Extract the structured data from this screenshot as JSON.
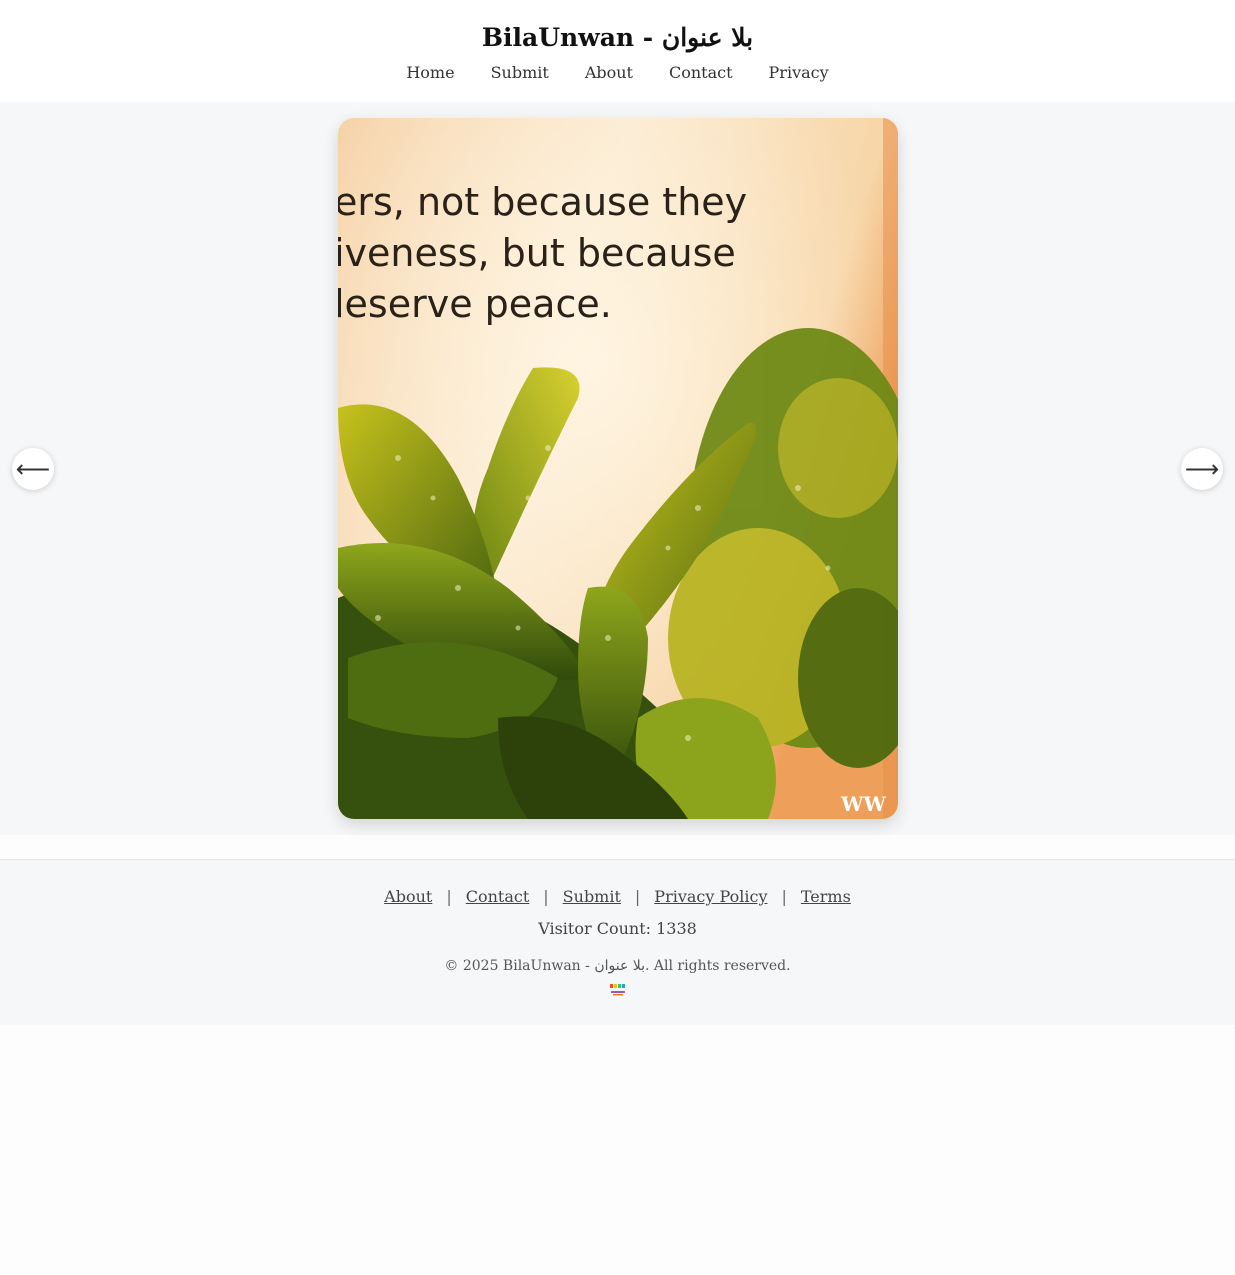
{
  "header": {
    "title": "BilaUnwan - بلا عنوان",
    "nav": [
      "Home",
      "Submit",
      "About",
      "Contact",
      "Privacy"
    ]
  },
  "slider": {
    "image_text": [
      "ers, not because they",
      "iveness, but because",
      "leserve peace."
    ],
    "watermark": "WW",
    "prev_icon": "arrow-left-icon",
    "next_icon": "arrow-right-icon",
    "prev_glyph": "⟵",
    "next_glyph": "⟶"
  },
  "footer": {
    "links": [
      "About",
      "Contact",
      "Submit",
      "Privacy Policy",
      "Terms"
    ],
    "separator": "|",
    "visitor_count": "Visitor Count: 1338",
    "copyright": "© 2025 BilaUnwan - بلا عنوان. All rights reserved.",
    "badge_icon": "site-badge-icon"
  },
  "colors": {
    "page_bg": "#f6f7f8",
    "header_bg": "#ffffff",
    "text": "#333333"
  }
}
